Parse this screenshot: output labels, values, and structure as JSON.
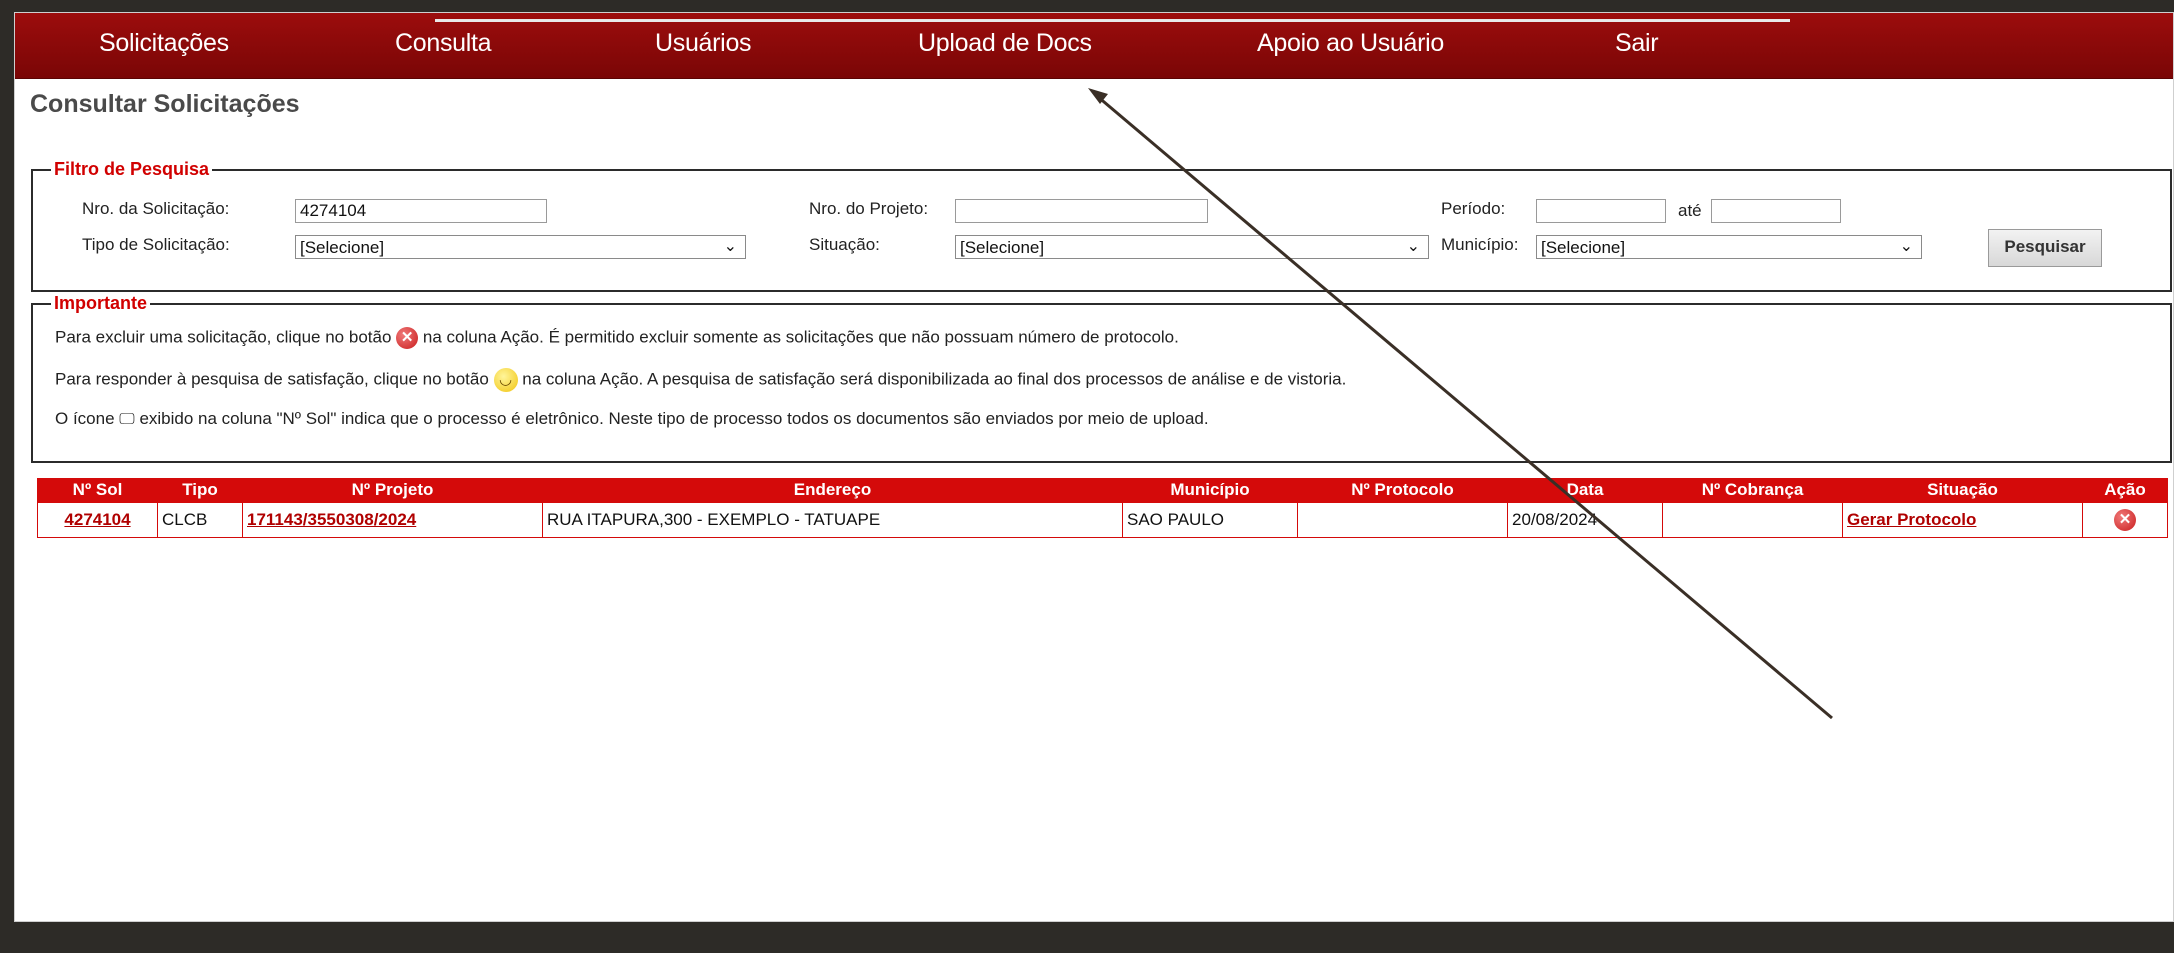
{
  "nav": {
    "items": [
      "Solicitações",
      "Consulta",
      "Usuários",
      "Upload de Docs",
      "Apoio ao Usuário",
      "Sair"
    ]
  },
  "page_title": "Consultar Solicitações",
  "filter": {
    "legend": "Filtro de Pesquisa",
    "nro_solicitacao_label": "Nro. da Solicitação:",
    "nro_solicitacao_value": "4274104",
    "nro_projeto_label": "Nro. do Projeto:",
    "nro_projeto_value": "",
    "periodo_label": "Período:",
    "periodo_ate": "até",
    "periodo_inicio": "",
    "periodo_fim": "",
    "tipo_label": "Tipo de Solicitação:",
    "tipo_value": "[Selecione]",
    "situacao_label": "Situação:",
    "situacao_value": "[Selecione]",
    "municipio_label": "Município:",
    "municipio_value": "[Selecione]",
    "search_button": "Pesquisar"
  },
  "important": {
    "legend": "Importante",
    "line1_a": "Para excluir uma solicitação, clique no botão",
    "line1_b": "na coluna Ação. É permitido excluir somente as solicitações que não possuam número de protocolo.",
    "line2_a": "Para responder à pesquisa de satisfação, clique no botão",
    "line2_b": "na coluna Ação. A pesquisa de satisfação será disponibilizada ao final dos processos de análise e de vistoria.",
    "line3_a": "O ícone",
    "line3_b": "exibido na coluna \"Nº Sol\" indica que o processo é eletrônico. Neste tipo de processo todos os documentos são enviados por meio de upload."
  },
  "table": {
    "headers": [
      "Nº Sol",
      "Tipo",
      "Nº Projeto",
      "Endereço",
      "Município",
      "Nº Protocolo",
      "Data",
      "Nº Cobrança",
      "Situação",
      "Ação"
    ],
    "rows": [
      {
        "sol": "4274104",
        "tipo": "CLCB",
        "projeto": "171143/3550308/2024",
        "endereco": "RUA ITAPURA,300 - EXEMPLO - TATUAPE",
        "municipio": "SAO PAULO",
        "protocolo": "",
        "data": "20/08/2024",
        "cobranca": "",
        "situacao": "Gerar Protocolo"
      }
    ]
  },
  "colors": {
    "nav_bg": "#8b0a0a",
    "accent_red": "#d40a0a",
    "link_red": "#b00000",
    "legend_red": "#d10000"
  },
  "icons": {
    "delete": "delete-icon",
    "satisfaction": "smiley-icon",
    "electronic": "computer-icon",
    "dropdown": "chevron-down-icon"
  }
}
